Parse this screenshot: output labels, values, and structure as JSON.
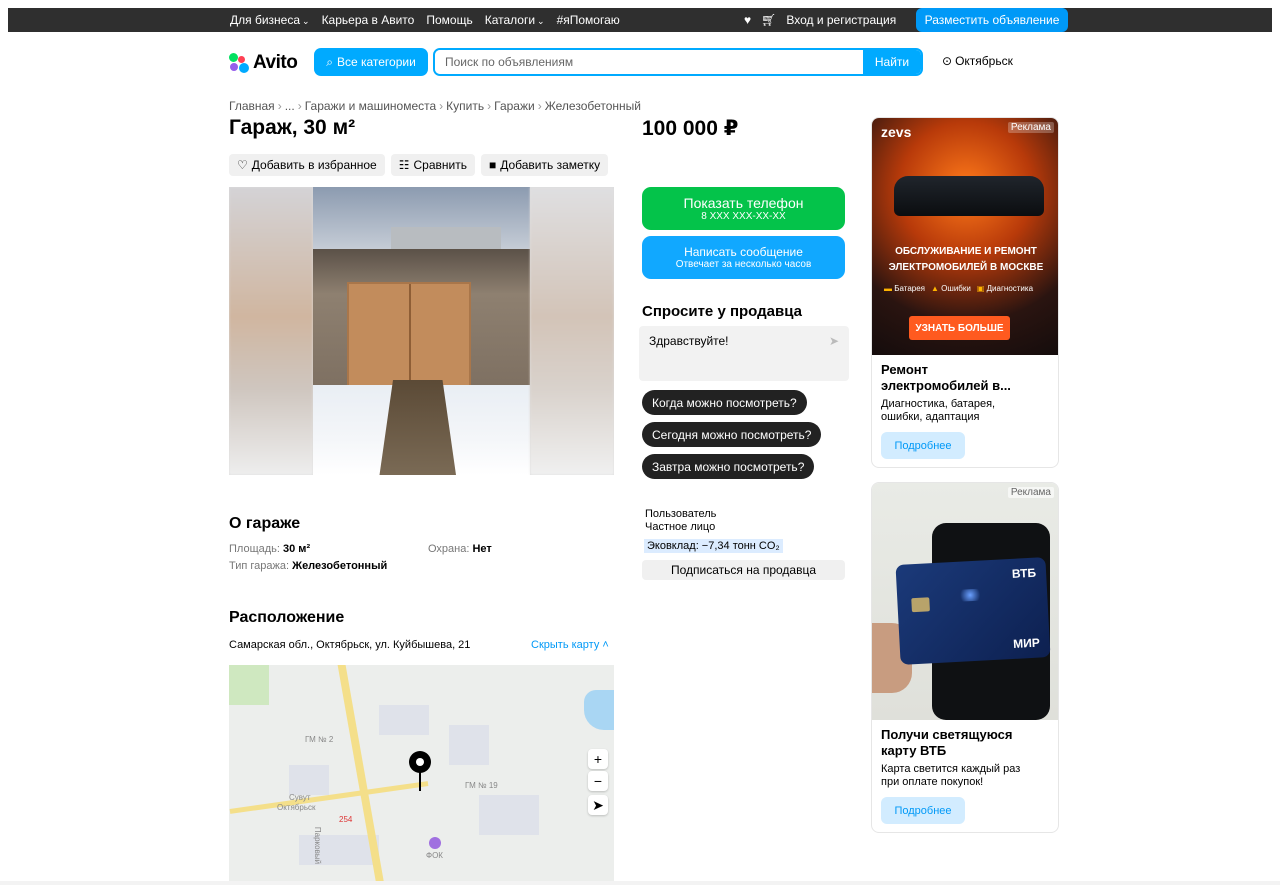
{
  "topbar": {
    "links": [
      {
        "label": "Для бизнеса",
        "chevron": true
      },
      {
        "label": "Карьера в Авито",
        "chevron": false
      },
      {
        "label": "Помощь",
        "chevron": false
      },
      {
        "label": "Каталоги",
        "chevron": true
      },
      {
        "label": "#яПомогаю",
        "chevron": false
      }
    ],
    "login": "Вход и регистрация",
    "post_ad": "Разместить объявление"
  },
  "header": {
    "logo": "Avito",
    "categories_button": "Все категории",
    "search_placeholder": "Поиск по объявлениям",
    "find_button": "Найти",
    "city": "Октябрьск"
  },
  "breadcrumb": [
    "Главная",
    "...",
    "Гаражи и машиноместа",
    "Купить",
    "Гаражи",
    "Железобетонный"
  ],
  "listing": {
    "title": "Гараж, 30 м²",
    "price": "100 000 ₽",
    "actions": [
      {
        "icon": "heart-icon",
        "label": "Добавить в избранное"
      },
      {
        "icon": "compare-icon",
        "label": "Сравнить"
      },
      {
        "icon": "note-icon",
        "label": "Добавить заметку"
      }
    ]
  },
  "contact": {
    "phone_label": "Показать телефон",
    "phone_masked": "8 XXX XXX-XX-XX",
    "message_label": "Написать сообщение",
    "message_sub": "Отвечает за несколько часов",
    "ask_title": "Спросите у продавца",
    "ask_input": "Здравствуйте!",
    "quick_questions": [
      "Когда можно посмотреть?",
      "Сегодня можно посмотреть?",
      "Завтра можно посмотреть?"
    ],
    "seller_name": "Пользователь",
    "seller_type": "Частное лицо",
    "eco": "Эковклад: −7,34 тонн CO₂",
    "subscribe": "Подписаться на продавца"
  },
  "about": {
    "title": "О гараже",
    "params": [
      {
        "label": "Площадь:",
        "value": "30 м²"
      },
      {
        "label": "Охрана:",
        "value": "Нет"
      },
      {
        "label": "Тип гаража:",
        "value": "Железобетонный"
      }
    ]
  },
  "location": {
    "title": "Расположение",
    "address": "Самарская обл., Октябрьск, ул. Куйбышева, 21",
    "hide_map": "Скрыть карту ˄",
    "map_labels": [
      "ГМ № 2",
      "ГМ № 19",
      "Сувут",
      "Октябрьск",
      "Парковый",
      "ФОК",
      "254"
    ]
  },
  "ads": [
    {
      "tag": "Реклама",
      "brand": "zevs",
      "headline_1": "ОБСЛУЖИВАНИЕ И РЕМОНТ",
      "headline_2": "ЭЛЕКТРОМОБИЛЕЙ В МОСКВЕ",
      "features": [
        "Батарея",
        "Ошибки",
        "Диагностика"
      ],
      "image_button": "УЗНАТЬ БОЛЬШЕ",
      "title_1": "Ремонт",
      "title_2": "электромобилей в...",
      "desc_1": "Диагностика, батарея,",
      "desc_2": "ошибки, адаптация",
      "button": "Подробнее"
    },
    {
      "tag": "Реклама",
      "card_brand": "ВТБ",
      "card_system": "МИР",
      "title_1": "Получи светящуюся",
      "title_2": "карту ВТБ",
      "desc_1": "Карта светится каждый раз",
      "desc_2": "при оплате покупок!",
      "button": "Подробнее"
    }
  ]
}
